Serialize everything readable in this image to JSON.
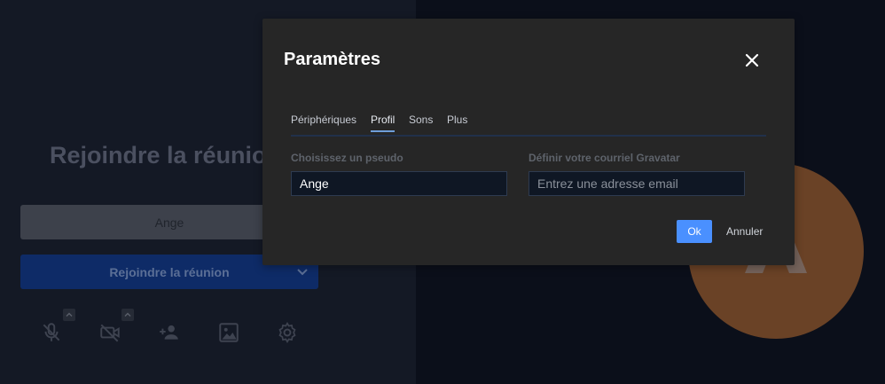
{
  "prejoin": {
    "title": "Rejoindre la réunion",
    "name_value": "Ange",
    "join_label": "Rejoindre la réunion",
    "toolbar_icons": [
      "microphone-muted-icon",
      "camera-off-icon",
      "add-person-icon",
      "background-image-icon",
      "settings-gear-icon"
    ]
  },
  "avatar": {
    "initial": "A",
    "color": "#6a4226"
  },
  "dialog": {
    "title": "Paramètres",
    "tabs": [
      {
        "label": "Périphériques",
        "active": false
      },
      {
        "label": "Profil",
        "active": true
      },
      {
        "label": "Sons",
        "active": false
      },
      {
        "label": "Plus",
        "active": false
      }
    ],
    "display_name": {
      "label": "Choisissez un pseudo",
      "value": "Ange"
    },
    "email": {
      "label": "Définir votre courriel Gravatar",
      "placeholder": "Entrez une adresse email",
      "value": ""
    },
    "ok_label": "Ok",
    "cancel_label": "Annuler"
  },
  "colors": {
    "accent": "#4a90ff",
    "tab_underline": "#6e9ed9",
    "dialog_bg": "#262626"
  }
}
